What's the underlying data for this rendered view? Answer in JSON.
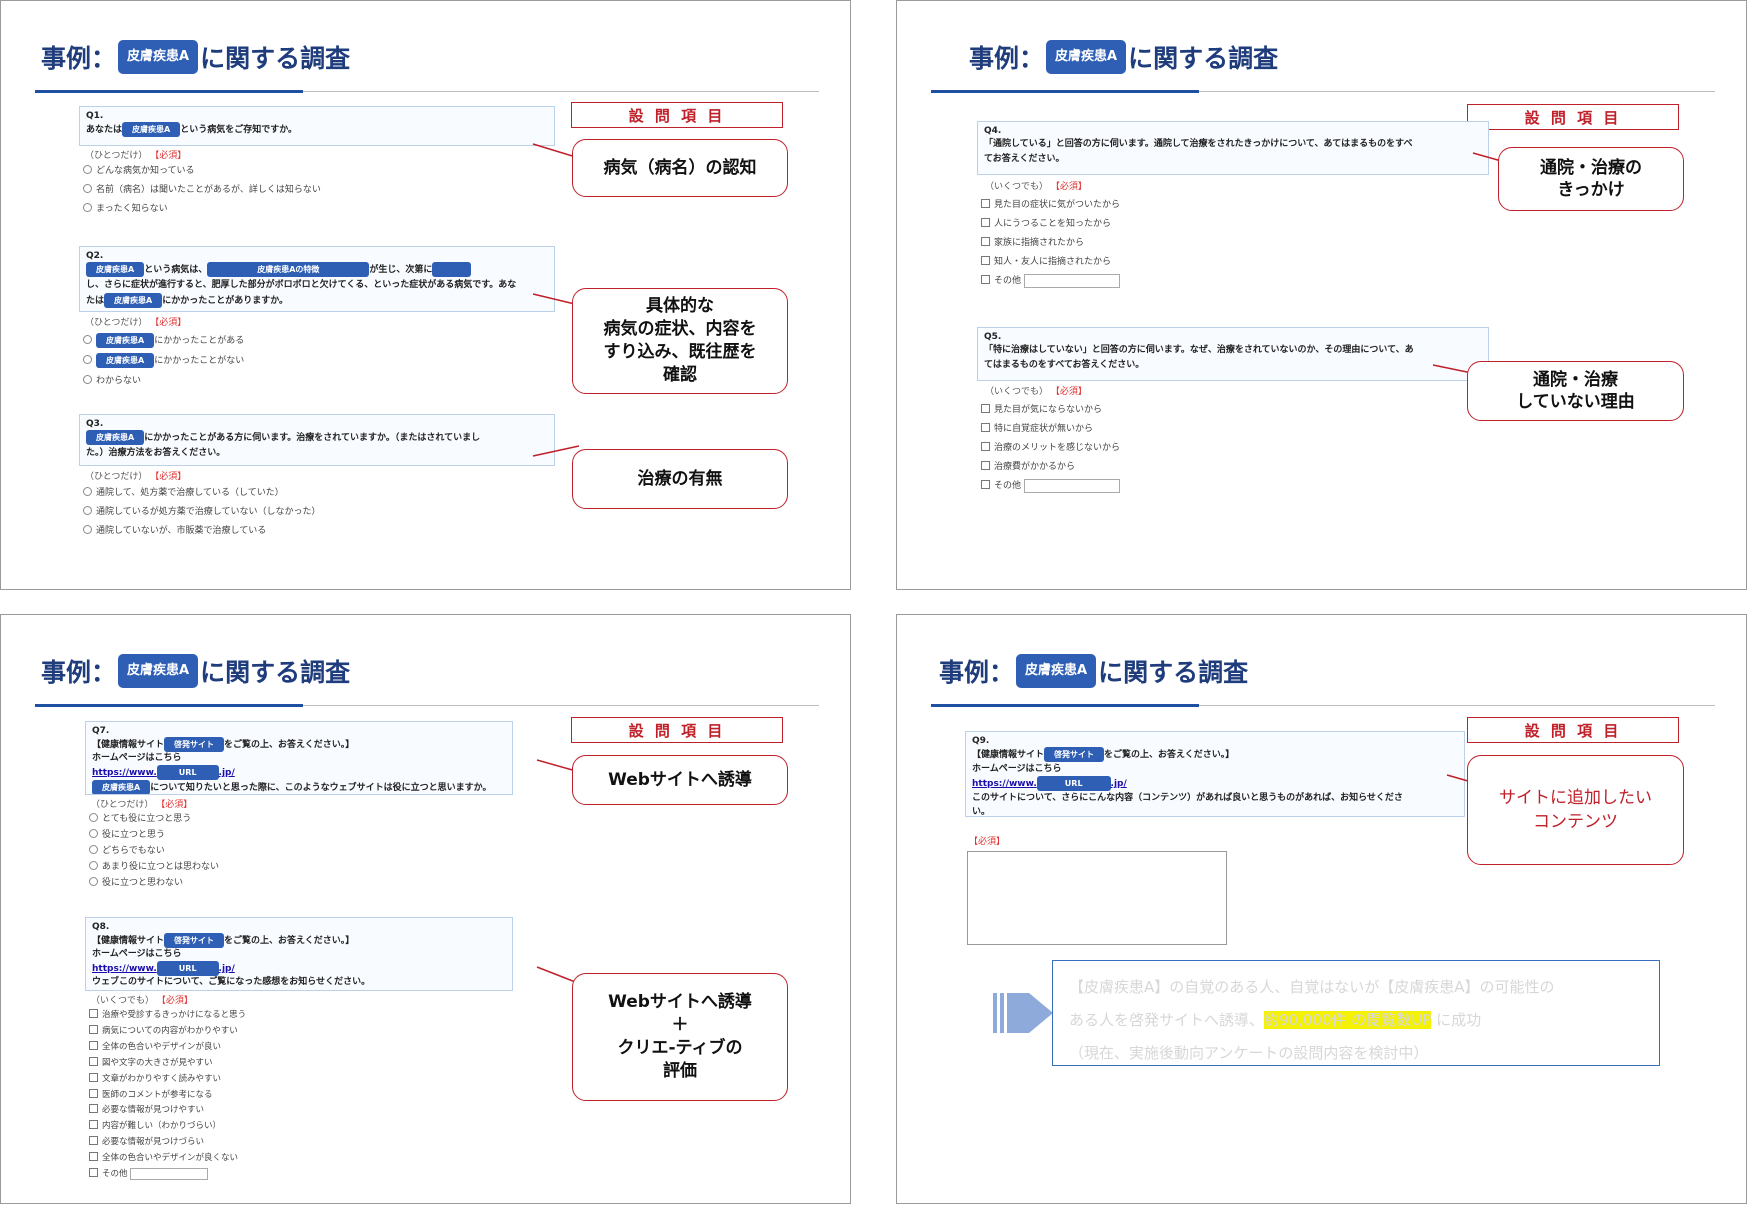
{
  "title": {
    "prefix": "事例：",
    "tag": "皮膚疾患A",
    "suffix": "に関する調査"
  },
  "section_label": "設 問 項 目",
  "required": "【必須】",
  "one_only": "（ひとつだけ）",
  "multi": "（いくつでも）",
  "pill": {
    "disease": "皮膚疾患A",
    "feature": "皮膚疾患Aの特徴",
    "site": "啓発サイト",
    "url": "URL"
  },
  "q1": {
    "num": "Q1.",
    "pre": "あなたは",
    "post": "という病気をご存知ですか。",
    "options": [
      "どんな病気か知っている",
      "名前（病名）は聞いたことがあるが、詳しくは知らない",
      "まったく知らない"
    ],
    "callout": "病気（病名）の認知"
  },
  "q2": {
    "num": "Q2.",
    "t1": "という病気は、",
    "t2": "が生じ、次第に",
    "t3": "し、さらに症状が進行すると、肥厚した部分がボロボロと欠けてくる、といった症状がある病気です。あな",
    "t4": "たは",
    "t5": "にかかったことがありますか。",
    "opt1": "にかかったことがある",
    "opt2": "にかかったことがない",
    "opt3": "わからない",
    "callout": "具体的な\n病気の症状、内容を\nすり込み、既往歴を\n確認"
  },
  "q3": {
    "num": "Q3.",
    "t1": "にかかったことがある方に伺います。治療をされていますか。（またはされていまし",
    "t2": "た。）治療方法をお答えください。",
    "options": [
      "通院して、処方薬で治療している（していた）",
      "通院しているが処方薬で治療していない（しなかった）",
      "通院していないが、市販薬で治療している"
    ],
    "callout": "治療の有無"
  },
  "q4": {
    "num": "Q4.",
    "t1": "「通院している」と回答の方に伺います。通院して治療をされたきっかけについて、あてはまるものをすべ",
    "t2": "てお答えください。",
    "options": [
      "見た目の症状に気がついたから",
      "人にうつることを知ったから",
      "家族に指摘されたから",
      "知人・友人に指摘されたから",
      "その他"
    ],
    "callout": "通院・治療の\nきっかけ"
  },
  "q5": {
    "num": "Q5.",
    "t1": "「特に治療はしていない」と回答の方に伺います。なぜ、治療をされていないのか、その理由について、あ",
    "t2": "てはまるものをすべてお答えください。",
    "options": [
      "見た目が気にならないから",
      "特に自覚症状が無いから",
      "治療のメリットを感じないから",
      "治療費がかかるから",
      "その他"
    ],
    "callout": "通院・治療\nしていない理由"
  },
  "q7": {
    "num": "Q7.",
    "t1": "【健康情報サイト",
    "t2": "をご覧の上、お答えください。】",
    "t3": "ホームページはこちら",
    "url_pre": "https://www.",
    "url_post": ".jp/",
    "t4": "について知りたいと思った際に、このようなウェブサイトは役に立つと思いますか。",
    "options": [
      "とても役に立つと思う",
      "役に立つと思う",
      "どちらでもない",
      "あまり役に立つとは思わない",
      "役に立つと思わない"
    ],
    "callout": "Webサイトへ誘導"
  },
  "q8": {
    "num": "Q8.",
    "t1": "【健康情報サイト",
    "t2": "をご覧の上、お答えください。】",
    "t3": "ホームページはこちら",
    "url_pre": "https://www.",
    "url_post": ".jp/",
    "t4": "ウェブこのサイトについて、ご覧になった感想をお知らせください。",
    "options": [
      "治療や受診するきっかけになると思う",
      "病気についての内容がわかりやすい",
      "全体の色合いやデザインが良い",
      "図や文字の大きさが見やすい",
      "文章がわかりやすく読みやすい",
      "医師のコメントが参考になる",
      "必要な情報が見つけやすい",
      "内容が難しい（わかりづらい）",
      "必要な情報が見つけづらい",
      "全体の色合いやデザインが良くない",
      "その他"
    ],
    "callout": "Webサイトへ誘導\n＋\nクリエ-ティブの\n評価"
  },
  "q9": {
    "num": "Q9.",
    "t1": "【健康情報サイト",
    "t2": "をご覧の上、お答えください。】",
    "t3": "ホームページはこちら",
    "url_pre": "https://www.",
    "url_post": ".jp/",
    "t4": "このサイトについて、さらにこんな内容（コンテンツ）があれば良いと思うものがあれば、お知らせくださ",
    "t5": "い。",
    "callout": "サイトに追加したい\nコンテンツ"
  },
  "summary": {
    "l1": "【皮膚疾患A】の自覚のある人、自覚はないが【皮膚疾患A】の可能性の",
    "l2a": "ある人を啓発サイトへ誘導、",
    "l2hl": "約90,000件 の閲覧数UP",
    "l2b": "に成功",
    "l3": "（現在、実施後動向アンケートの設問内容を検討中）"
  },
  "colors": {
    "navy": "#1f3c7c",
    "pill_blue": "#2e5fb5",
    "callout_red": "#c0202a",
    "highlight": "#f5f200"
  }
}
